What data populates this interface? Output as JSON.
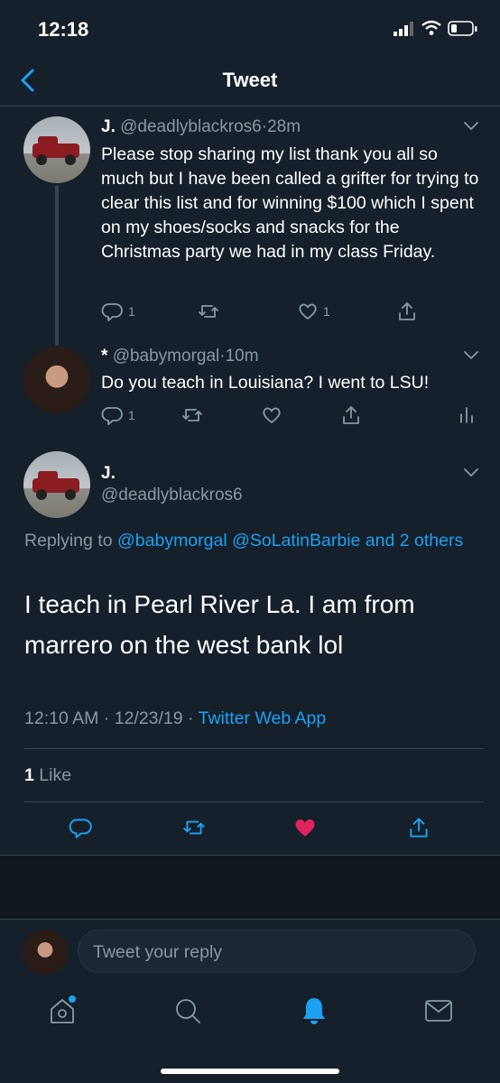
{
  "status_bar": {
    "time": "12:18"
  },
  "header": {
    "title": "Tweet"
  },
  "tweet1": {
    "name": "J.",
    "handle": "@deadlyblackros6",
    "sep": "·",
    "time": "28m",
    "text": "Please stop sharing my list thank you all so much but I have been called a grifter for trying to clear this list and for winning $100 which I spent on my shoes/socks and snacks for the Christmas party we had in my class Friday.",
    "reply_count": "1",
    "like_count": "1"
  },
  "tweet2": {
    "name": "*",
    "handle": "@babymorgal",
    "sep": "·",
    "time": "10m",
    "text": "Do you teach in Louisiana? I went to LSU!",
    "reply_count": "1"
  },
  "main": {
    "name": "J.",
    "handle": "@deadlyblackros6",
    "replying_prefix": "Replying to",
    "replying_to": "@babymorgal @SoLatinBarbie and 2 others",
    "text": "I teach in Pearl River La. I am from marrero on the west bank lol",
    "timestamp": "12:10 AM · 12/23/19 · ",
    "source": "Twitter Web App",
    "like_count": "1",
    "like_label": "Like"
  },
  "compose": {
    "placeholder": "Tweet your reply"
  },
  "colors": {
    "background": "#15202b",
    "accent": "#1da1f2",
    "like": "#e0245e",
    "muted": "#8899a6",
    "divider": "#38444d"
  }
}
